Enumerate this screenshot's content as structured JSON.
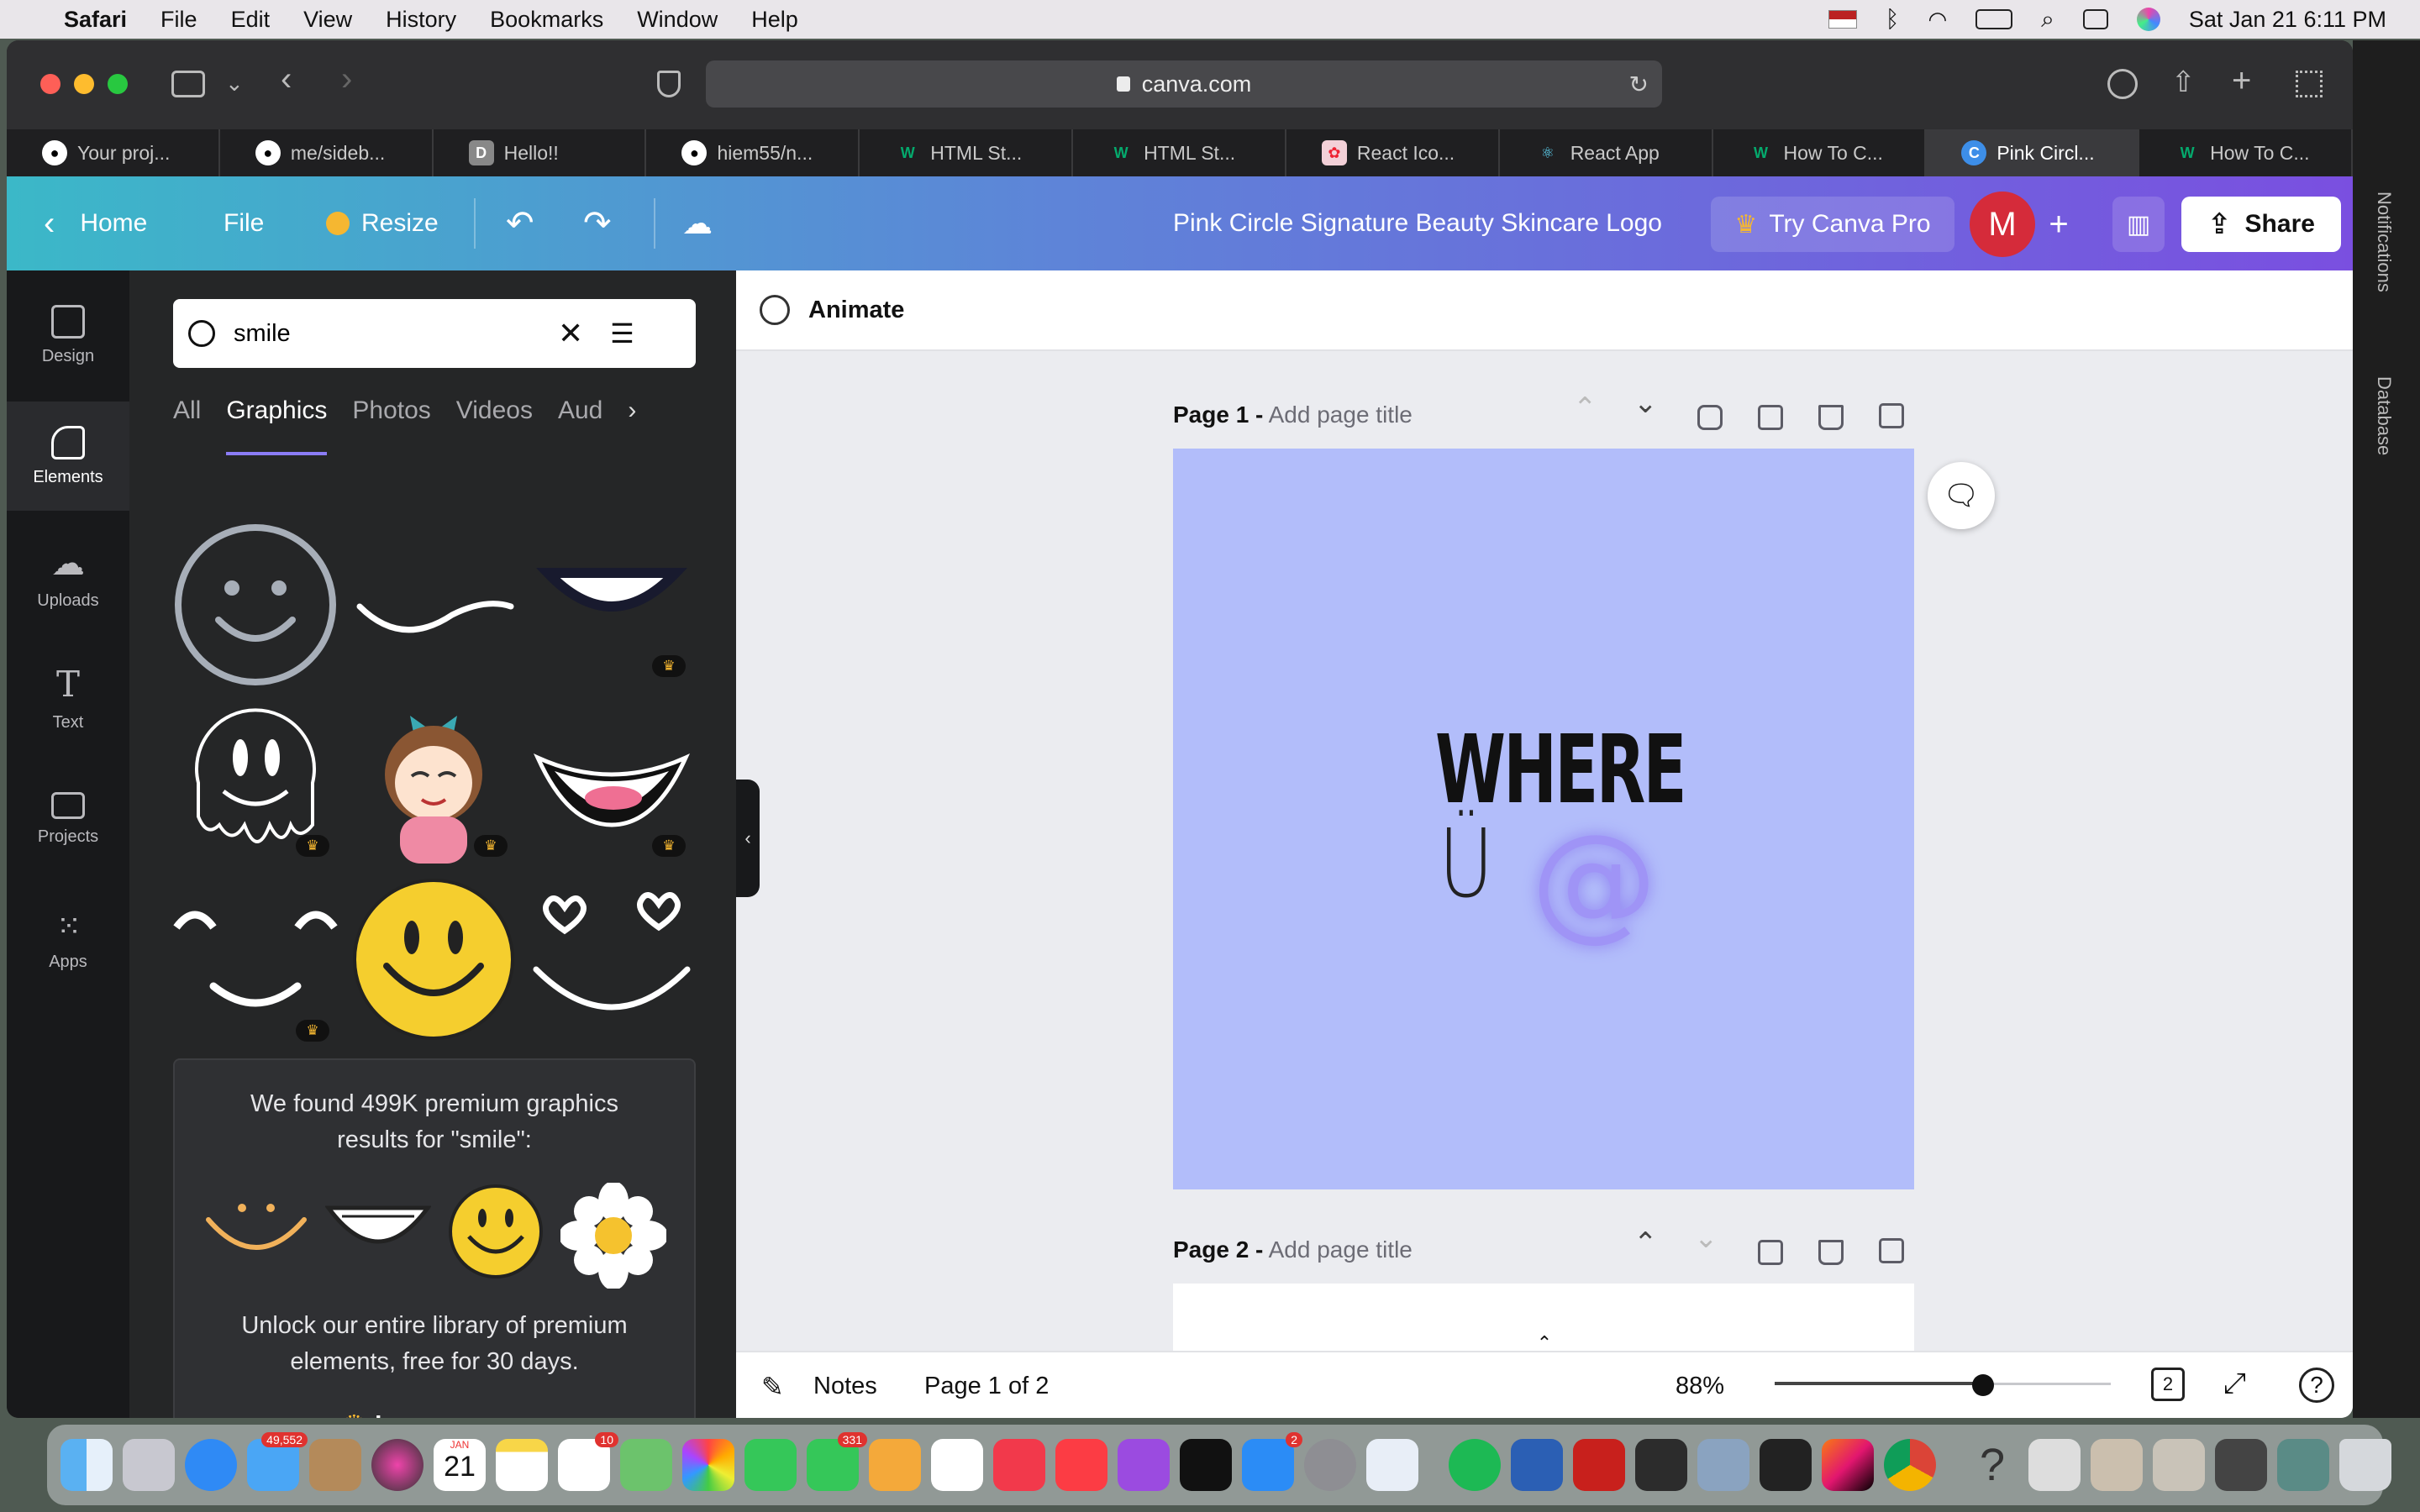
{
  "menubar": {
    "app": "Safari",
    "items": [
      "File",
      "Edit",
      "View",
      "History",
      "Bookmarks",
      "Window",
      "Help"
    ],
    "datetime": "Sat Jan 21  6:11 PM"
  },
  "browser": {
    "url": "canva.com",
    "tabs": [
      {
        "label": "Your proj...",
        "icon": "github"
      },
      {
        "label": "me/sideb...",
        "icon": "github"
      },
      {
        "label": "Hello!!",
        "icon": "D"
      },
      {
        "label": "hiem55/n...",
        "icon": "github"
      },
      {
        "label": "HTML St...",
        "icon": "w3"
      },
      {
        "label": "HTML St...",
        "icon": "w3"
      },
      {
        "label": "React Ico...",
        "icon": "react-icons"
      },
      {
        "label": "React App",
        "icon": "react"
      },
      {
        "label": "How To C...",
        "icon": "w3"
      },
      {
        "label": "Pink Circl...",
        "icon": "canva",
        "active": true
      },
      {
        "label": "How To C...",
        "icon": "w3"
      }
    ]
  },
  "canva_header": {
    "home": "Home",
    "file": "File",
    "resize": "Resize",
    "title": "Pink Circle  Signature Beauty Skincare Logo",
    "try_pro": "Try Canva Pro",
    "avatar": "M",
    "share": "Share"
  },
  "rail": [
    {
      "label": "Design",
      "icon": "design-icon"
    },
    {
      "label": "Elements",
      "icon": "elements-icon",
      "active": true
    },
    {
      "label": "Uploads",
      "icon": "uploads-icon"
    },
    {
      "label": "Text",
      "icon": "text-icon"
    },
    {
      "label": "Projects",
      "icon": "folder-icon"
    },
    {
      "label": "Apps",
      "icon": "apps-icon"
    }
  ],
  "panel": {
    "search_value": "smile",
    "tabs": [
      "All",
      "Graphics",
      "Photos",
      "Videos",
      "Aud"
    ],
    "active_tab": "Graphics",
    "promo": {
      "line1": "We found 499K premium graphics",
      "line2": "results for \"smile\":",
      "unlock1": "Unlock our entire library of premium",
      "unlock2": "elements, free for 30 days.",
      "learn_more": "Learn more"
    }
  },
  "editor": {
    "animate": "Animate",
    "page1": {
      "label": "Page 1 -",
      "placeholder": "Add page title",
      "design_line1": "WHERE",
      "design_u": "Ü",
      "design_at": "@"
    },
    "page2": {
      "label": "Page 2 -",
      "placeholder": "Add page title"
    }
  },
  "bottom": {
    "notes": "Notes",
    "page_indicator": "Page 1 of 2",
    "zoom": "88%",
    "zoom_fraction": 0.62,
    "page_count": "2"
  },
  "right_sidebar": {
    "notifications": "Notifications",
    "database": "Database"
  },
  "dock": {
    "badges": {
      "mail": "49,552",
      "messages": "331",
      "reminders": "10",
      "appstore": "2",
      "calendar_day": "21",
      "calendar_month": "JAN"
    }
  },
  "colors": {
    "page_bg": "#b2bdfa",
    "accent": "#8b7cf6",
    "avatar": "#d52b3a"
  }
}
